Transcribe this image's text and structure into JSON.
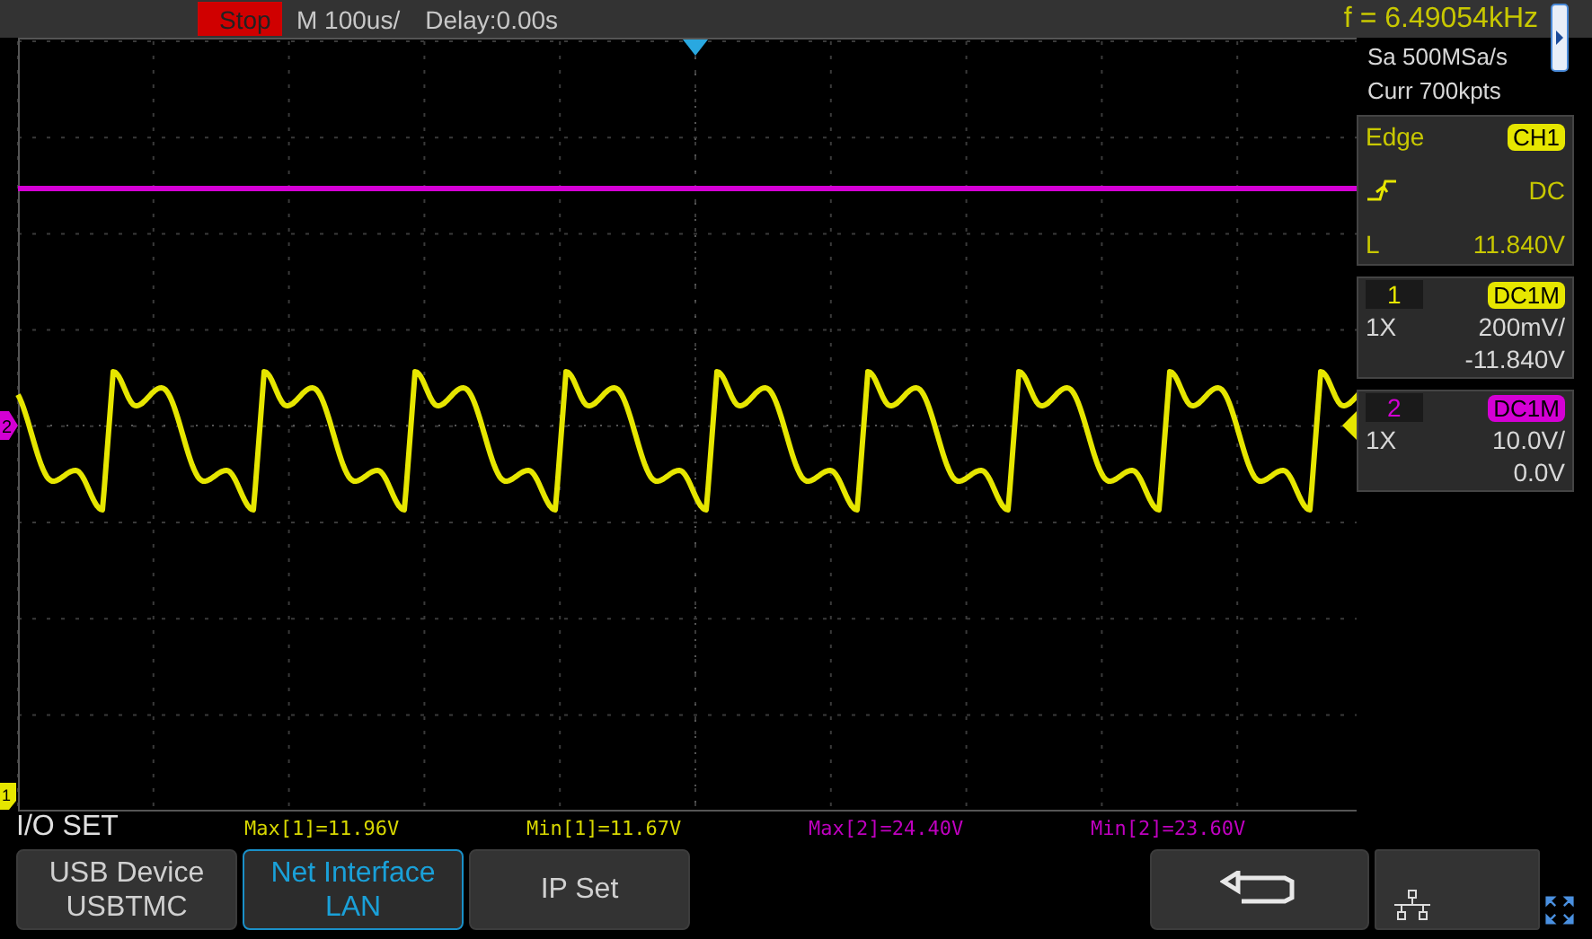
{
  "top_bar": {
    "run_state": "Stop",
    "timebase": "M 100us/",
    "delay": "Delay:0.00s",
    "frequency": "f = 6.49054kHz"
  },
  "acquisition": {
    "sample_rate": "Sa 500MSa/s",
    "memory": "Curr 700kpts"
  },
  "trigger": {
    "type": "Edge",
    "source": "CH1",
    "coupling": "DC",
    "level_label": "L",
    "level_value": "11.840V"
  },
  "channels": [
    {
      "number": "1",
      "coupling": "DC1M",
      "probe": "1X",
      "scale": "200mV/",
      "offset": "-11.840V",
      "color": "#e6e600"
    },
    {
      "number": "2",
      "coupling": "DC1M",
      "probe": "1X",
      "scale": "10.0V/",
      "offset": "0.0V",
      "color": "#d400d4"
    }
  ],
  "channel_markers": [
    {
      "label": "2",
      "color": "#d400d4"
    },
    {
      "label": "1",
      "color": "#e6e600"
    }
  ],
  "menu": {
    "title": "I/O SET",
    "buttons": [
      {
        "lines": [
          "USB Device",
          "USBTMC"
        ],
        "selected": false
      },
      {
        "lines": [
          "Net Interface",
          "LAN"
        ],
        "selected": true
      },
      {
        "lines": [
          "IP Set"
        ],
        "selected": false
      }
    ]
  },
  "measurements": [
    {
      "text": "Max[1]=11.96V",
      "color": "#d8d800"
    },
    {
      "text": "Min[1]=11.67V",
      "color": "#d8d800"
    },
    {
      "text": "Max[2]=24.40V",
      "color": "#c000c0"
    },
    {
      "text": "Min[2]=23.60V",
      "color": "#c000c0"
    }
  ]
}
